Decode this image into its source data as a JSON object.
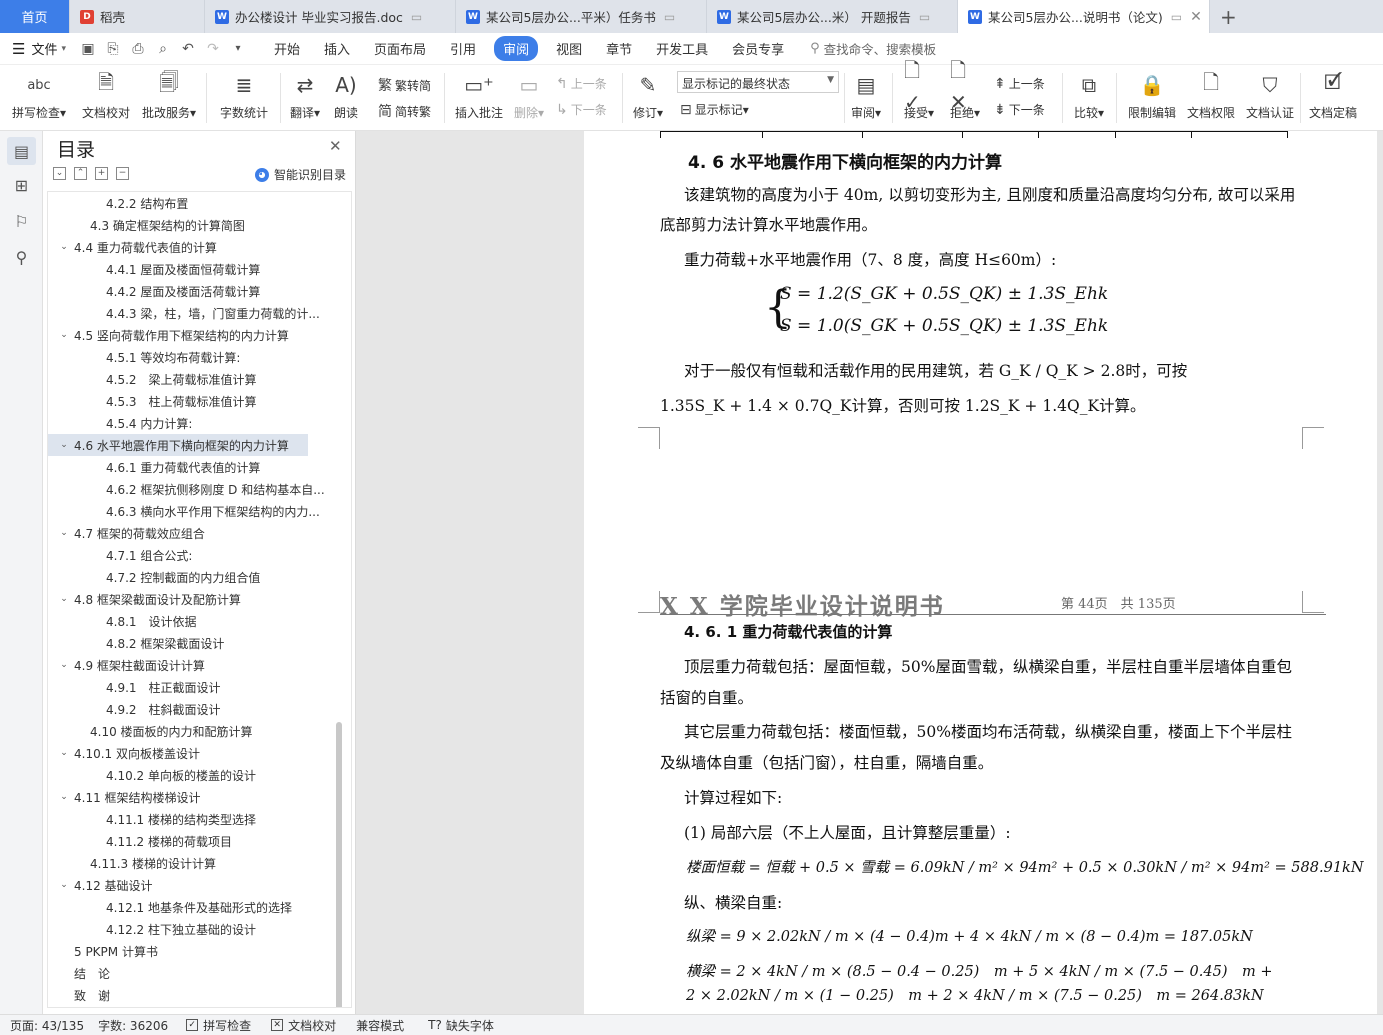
{
  "tabs": [
    {
      "label": "首页",
      "kind": "home"
    },
    {
      "label": "稻壳",
      "icon": "docer-icon"
    },
    {
      "label": "办公楼设计 毕业实习报告.doc",
      "icon": "word-icon"
    },
    {
      "label": "某公司5层办公...平米）任务书",
      "icon": "word-icon"
    },
    {
      "label": "某公司5层办公...米） 开题报告",
      "icon": "word-icon"
    },
    {
      "label": "某公司5层办公...说明书（论文)",
      "icon": "word-icon",
      "active": true
    }
  ],
  "menu": {
    "file_label": "文件",
    "items": [
      "开始",
      "插入",
      "页面布局",
      "引用",
      "审阅",
      "视图",
      "章节",
      "开发工具",
      "会员专享"
    ],
    "active": "审阅",
    "search_placeholder": "查找命令、搜索模板"
  },
  "ribbon": {
    "spell_check": "拼写检查",
    "doc_proof": "文档校对",
    "batch_service": "批改服务",
    "word_count": "字数统计",
    "translate": "翻译",
    "read_aloud": "朗读",
    "to_traditional": "繁转简",
    "to_simplified": "简转繁",
    "insert_comment": "插入批注",
    "delete": "删除",
    "prev_comment": "上一条",
    "next_comment": "下一条",
    "track_changes": "修订",
    "display_select": "显示标记的最终状态",
    "show_markup": "显示标记",
    "review": "审阅",
    "accept": "接受",
    "reject": "拒绝",
    "prev_change": "上一条",
    "next_change": "下一条",
    "compare": "比较",
    "restrict_edit": "限制编辑",
    "doc_permission": "文档权限",
    "doc_certify": "文档认证",
    "doc_finalize": "文档定稿"
  },
  "toc": {
    "title": "目录",
    "smart_label": "智能识别目录",
    "items": [
      {
        "text": "4.2.2 结构布置",
        "level": 3
      },
      {
        "text": "4.3 确定框架结构的计算简图",
        "level": 2
      },
      {
        "text": "4.4 重力荷载代表值的计算",
        "level": 2,
        "expanded": true
      },
      {
        "text": "4.4.1 屋面及楼面恒荷载计算",
        "level": 3
      },
      {
        "text": "4.4.2 屋面及楼面活荷载计算",
        "level": 3
      },
      {
        "text": "4.4.3 梁，柱，墙，门窗重力荷载的计...",
        "level": 3
      },
      {
        "text": "4.5 竖向荷载作用下框架结构的内力计算",
        "level": 2,
        "expanded": true
      },
      {
        "text": "4.5.1 等效均布荷载计算:",
        "level": 3
      },
      {
        "text": "4.5.2　梁上荷载标准值计算",
        "level": 3
      },
      {
        "text": "4.5.3　柱上荷载标准值计算",
        "level": 3
      },
      {
        "text": "4.5.4 内力计算:",
        "level": 3
      },
      {
        "text": "4.6 水平地震作用下横向框架的内力计算",
        "level": 2,
        "expanded": true,
        "selected": true
      },
      {
        "text": "4.6.1 重力荷载代表值的计算",
        "level": 3
      },
      {
        "text": "4.6.2 框架抗侧移刚度 D 和结构基本自...",
        "level": 3
      },
      {
        "text": "4.6.3 横向水平作用下框架结构的内力...",
        "level": 3
      },
      {
        "text": "4.7 框架的荷载效应组合",
        "level": 2,
        "expanded": true
      },
      {
        "text": "4.7.1 组合公式:",
        "level": 3
      },
      {
        "text": "4.7.2 控制截面的内力组合值",
        "level": 3
      },
      {
        "text": "4.8 框架梁截面设计及配筋计算",
        "level": 2,
        "expanded": true
      },
      {
        "text": "4.8.1　设计依据",
        "level": 3
      },
      {
        "text": "4.8.2 框架梁截面设计",
        "level": 3
      },
      {
        "text": "4.9 框架柱截面设计计算",
        "level": 2,
        "expanded": true
      },
      {
        "text": "4.9.1　柱正截面设计",
        "level": 3
      },
      {
        "text": "4.9.2　柱斜截面设计",
        "level": 3
      },
      {
        "text": "4.10 楼面板的内力和配筋计算",
        "level": 2
      },
      {
        "text": "4.10.1 双向板楼盖设计",
        "level": 2,
        "expanded": true
      },
      {
        "text": "4.10.2 单向板的楼盖的设计",
        "level": 3
      },
      {
        "text": "4.11 框架结构楼梯设计",
        "level": 2,
        "expanded": true
      },
      {
        "text": "4.11.1 楼梯的结构类型选择",
        "level": 3
      },
      {
        "text": "4.11.2 楼梯的荷载项目",
        "level": 3
      },
      {
        "text": "4.11.3 楼梯的设计计算",
        "level": 2
      },
      {
        "text": "4.12 基础设计",
        "level": 2,
        "expanded": true
      },
      {
        "text": "4.12.1 地基条件及基础形式的选择",
        "level": 3
      },
      {
        "text": "4.12.2 柱下独立基础的设计",
        "level": 3
      },
      {
        "text": "5 PKPM 计算书",
        "level": 1
      },
      {
        "text": "结　论",
        "level": 1
      },
      {
        "text": "致　谢",
        "level": 1
      }
    ]
  },
  "page1": {
    "heading": "4. 6 水平地震作用下横向框架的内力计算",
    "p1a": "该建筑物的高度为小于 40m, 以剪切变形为主, 且刚度和质量沿高度均匀分布, 故可以采用",
    "p1b": "底部剪力法计算水平地震作用。",
    "p2": "重力荷载+水平地震作用（7、8 度，高度 H≤60m）:",
    "eq1": "S = 1.2(S_GK + 0.5S_QK) ± 1.3S_Ehk",
    "eq2": "S = 1.0(S_GK + 0.5S_QK) ± 1.3S_Ehk",
    "p3": "对于一般仅有恒载和活载作用的民用建筑，若 G_K / Q_K > 2.8时，可按",
    "p4": "1.35S_K + 1.4 × 0.7Q_K计算，否则可按 1.2S_K + 1.4Q_K计算。"
  },
  "page2": {
    "header_left": "X X  学院毕业设计说明书",
    "header_right": "第 44页　共 135页",
    "heading": "4. 6. 1 重力荷载代表值的计算",
    "p1a": "顶层重力荷载包括：屋面恒载，50%屋面雪载，纵横梁自重，半层柱自重半层墙体自重包",
    "p1b": "括窗的自重。",
    "p2a": "其它层重力荷载包括：楼面恒载，50%楼面均布活荷载，纵横梁自重，楼面上下个半层柱",
    "p2b": "及纵墙体自重（包括门窗），柱自重，隔墙自重。",
    "p3": "计算过程如下:",
    "p4": "(1)  局部六层（不上人屋面，且计算整层重量）:",
    "eq1": "楼面恒载 = 恒载 + 0.5 × 雪载 = 6.09kN / m² × 94m² + 0.5 × 0.30kN / m² × 94m² = 588.91kN",
    "p5": "纵、横梁自重:",
    "eq2": "纵梁 = 9 × 2.02kN / m × (4 − 0.4)m + 4 × 4kN / m × (8 − 0.4)m = 187.05kN",
    "eq3a": "横梁 = 2 × 4kN / m × (8.5 − 0.4 − 0.25)　m + 5 × 4kN / m × (7.5 − 0.45)　m +",
    "eq3b": "2 × 2.02kN / m × (1 − 0.25)　m + 2 × 4kN / m × (7.5 − 0.25)　m = 264.83kN"
  },
  "status": {
    "page": "页面: 43/135",
    "words": "字数: 36206",
    "spell": "拼写检查",
    "proof": "文档校对",
    "compat": "兼容模式",
    "missing_font": "缺失字体"
  }
}
